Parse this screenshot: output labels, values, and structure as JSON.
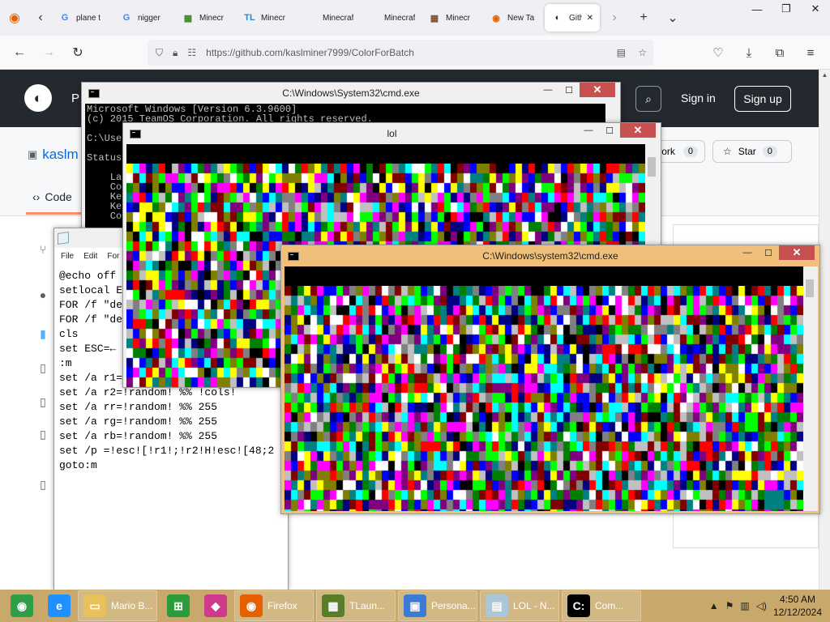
{
  "browser": {
    "tabs": [
      {
        "icon": "google-icon",
        "glyph": "G",
        "color": "#4285f4",
        "label": "plane t"
      },
      {
        "icon": "google-icon",
        "glyph": "G",
        "color": "#4285f4",
        "label": "nigger"
      },
      {
        "icon": "minecraft-icon",
        "glyph": "▦",
        "color": "#3c8527",
        "label": "Minecr"
      },
      {
        "icon": "tl-icon",
        "glyph": "TL",
        "color": "#2a84d2",
        "label": "Minecr"
      },
      {
        "icon": "blank-icon",
        "glyph": "",
        "color": "#f0f0f4",
        "label": "Minecraft C"
      },
      {
        "icon": "blank-icon",
        "glyph": "",
        "color": "#f0f0f4",
        "label": "Minecraft C"
      },
      {
        "icon": "minecraft-grass-icon",
        "glyph": "▦",
        "color": "#7a5230",
        "label": "Minecr"
      },
      {
        "icon": "firefox-icon",
        "glyph": "◉",
        "color": "#e66000",
        "label": "New Ta"
      },
      {
        "icon": "github-icon",
        "glyph": "◐",
        "color": "#24292f",
        "label": "Gith"
      }
    ],
    "url": "https://github.com/kaslminer7999/ColorForBatch"
  },
  "github": {
    "header_partial": "P",
    "sign_in": "Sign in",
    "sign_up": "Sign up",
    "repo_partial": "kaslm",
    "fork_label": "ork",
    "fork_count": "0",
    "star_label": "Star",
    "star_count": "0",
    "code_tab": "Code"
  },
  "cmd_back": {
    "title": "C:\\Windows\\System32\\cmd.exe",
    "lines": [
      "Microsoft Windows [Version 6.3.9600]",
      "(c) 2015 TeamOS Corporation. All rights reserved.",
      "",
      "C:\\Use",
      "",
      "Status",
      "",
      "    La",
      "    Co",
      "    Ke",
      "    Ke",
      "    Co"
    ]
  },
  "lol_window": {
    "title": "lol"
  },
  "cmd_front": {
    "title": "C:\\Windows\\system32\\cmd.exe"
  },
  "notepad": {
    "menu": [
      "File",
      "Edit",
      "For"
    ],
    "lines": [
      "@echo off",
      "setlocal E",
      "FOR /f \"de",
      "FOR /f \"de",
      "cls",
      "set ESC=←",
      ":m",
      "set /a r1=",
      "set /a r2=!random! %% !cols!",
      "set /a rr=!random! %% 255",
      "set /a rg=!random! %% 255",
      "set /a rb=!random! %% 255",
      "set /p =!esc![!r1!;!r2!H!esc![48;2",
      "goto:m"
    ]
  },
  "palette": [
    "#000000",
    "#800000",
    "#008000",
    "#808000",
    "#000080",
    "#800080",
    "#008080",
    "#c0c0c0",
    "#808080",
    "#ff0000",
    "#00ff00",
    "#ffff00",
    "#0000ff",
    "#ff00ff",
    "#00ffff",
    "#ffffff"
  ],
  "taskbar": {
    "items": [
      {
        "icon": "chrome-icon",
        "glyph": "◉",
        "color": "#2e9e48",
        "label": ""
      },
      {
        "icon": "internet-explorer-icon",
        "glyph": "e",
        "color": "#1e90ff",
        "label": ""
      },
      {
        "icon": "folder-icon",
        "glyph": "▭",
        "color": "#e8c15a",
        "label": "Mario B..."
      },
      {
        "icon": "store-icon",
        "glyph": "⊞",
        "color": "#2a9c3a",
        "label": ""
      },
      {
        "icon": "app-icon",
        "glyph": "◆",
        "color": "#d03a8c",
        "label": ""
      },
      {
        "icon": "firefox-icon",
        "glyph": "◉",
        "color": "#e66000",
        "label": "Firefox"
      },
      {
        "icon": "tlauncher-icon",
        "glyph": "▦",
        "color": "#5a7d2a",
        "label": "TLaun..."
      },
      {
        "icon": "personalize-icon",
        "glyph": "▣",
        "color": "#3a7bd5",
        "label": "Persona..."
      },
      {
        "icon": "notepad-icon",
        "glyph": "▤",
        "color": "#a9c7d9",
        "label": "LOL - N..."
      },
      {
        "icon": "cmd-icon",
        "glyph": "C:",
        "color": "#000000",
        "label": "Com..."
      }
    ],
    "time": "4:50 AM",
    "date": "12/12/2024"
  }
}
